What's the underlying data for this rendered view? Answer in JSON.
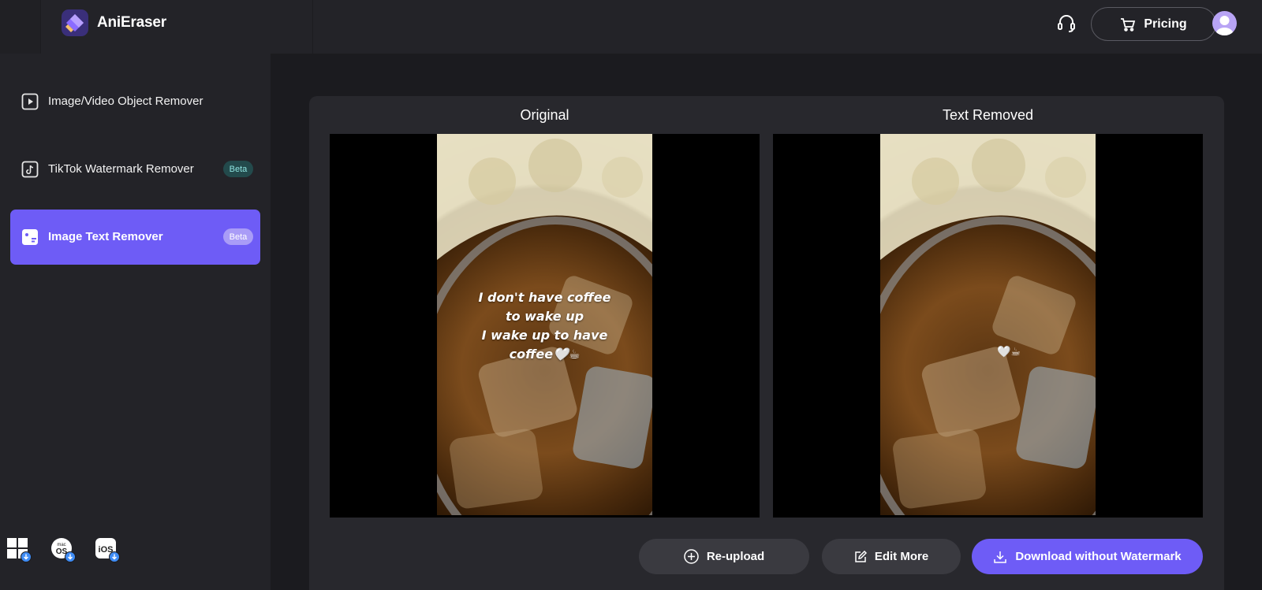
{
  "app": {
    "name": "AniEraser",
    "colors": {
      "accent": "#6e5cf6",
      "background": "#1b1b1f",
      "surface": "#28282d"
    }
  },
  "header": {
    "support_icon": "headset-icon",
    "pricing_label": "Pricing",
    "pricing_icon": "cart-icon",
    "avatar_icon": "user-avatar-icon"
  },
  "sidebar": {
    "items": [
      {
        "label": "Image/Video Object Remover",
        "icon": "play-square-icon",
        "badge": "",
        "active": false
      },
      {
        "label": "TikTok Watermark Remover",
        "icon": "tiktok-icon",
        "badge": "Beta",
        "active": false
      },
      {
        "label": "Image Text Remover",
        "icon": "image-text-icon",
        "badge": "Beta",
        "active": true
      }
    ],
    "platforms": [
      {
        "name": "windows-download-icon"
      },
      {
        "name": "macos-download-icon",
        "text_top": "mac",
        "text_main": "OS"
      },
      {
        "name": "ios-download-icon",
        "text_main": "iOS"
      }
    ]
  },
  "main": {
    "original_title": "Original",
    "result_title": "Text Removed",
    "original_overlay_text": [
      "I don't have coffee",
      "to wake up",
      "I wake up to have",
      "coffee🤍☕"
    ],
    "residual_mark": "🤍☕",
    "buttons": {
      "reupload": "Re-upload",
      "edit_more": "Edit More",
      "download": "Download without Watermark"
    }
  }
}
